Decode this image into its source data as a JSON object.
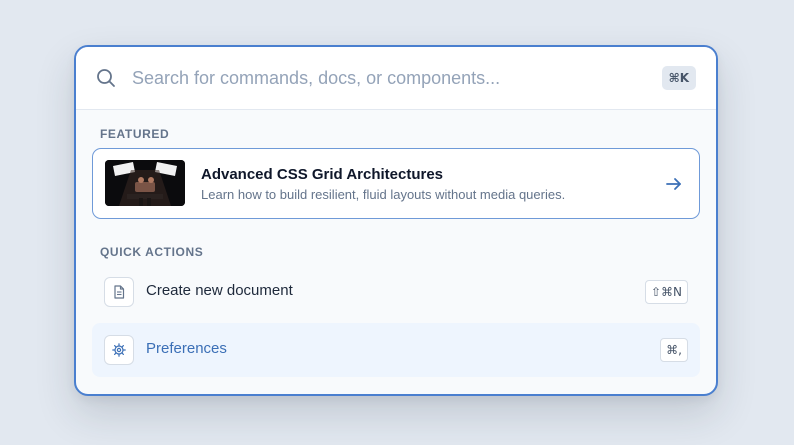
{
  "search": {
    "placeholder": "Search for commands, docs, or components...",
    "value": "",
    "shortcut": "⌘K"
  },
  "featured": {
    "section_label": "FEATURED",
    "title": "Advanced CSS Grid Architectures",
    "description": "Learn how to build resilient, fluid layouts without media queries."
  },
  "quick_actions": {
    "section_label": "QUICK ACTIONS",
    "items": [
      {
        "label": "Create new document",
        "shortcut": "⇧⌘N",
        "icon": "document-icon"
      },
      {
        "label": "Preferences",
        "shortcut": "⌘,",
        "icon": "gear-icon"
      }
    ]
  },
  "colors": {
    "accent": "#4a7fcf",
    "selected_bg": "#eef5fe",
    "selected_text": "#3b6fb6",
    "page_bg": "#e2e8f0"
  }
}
